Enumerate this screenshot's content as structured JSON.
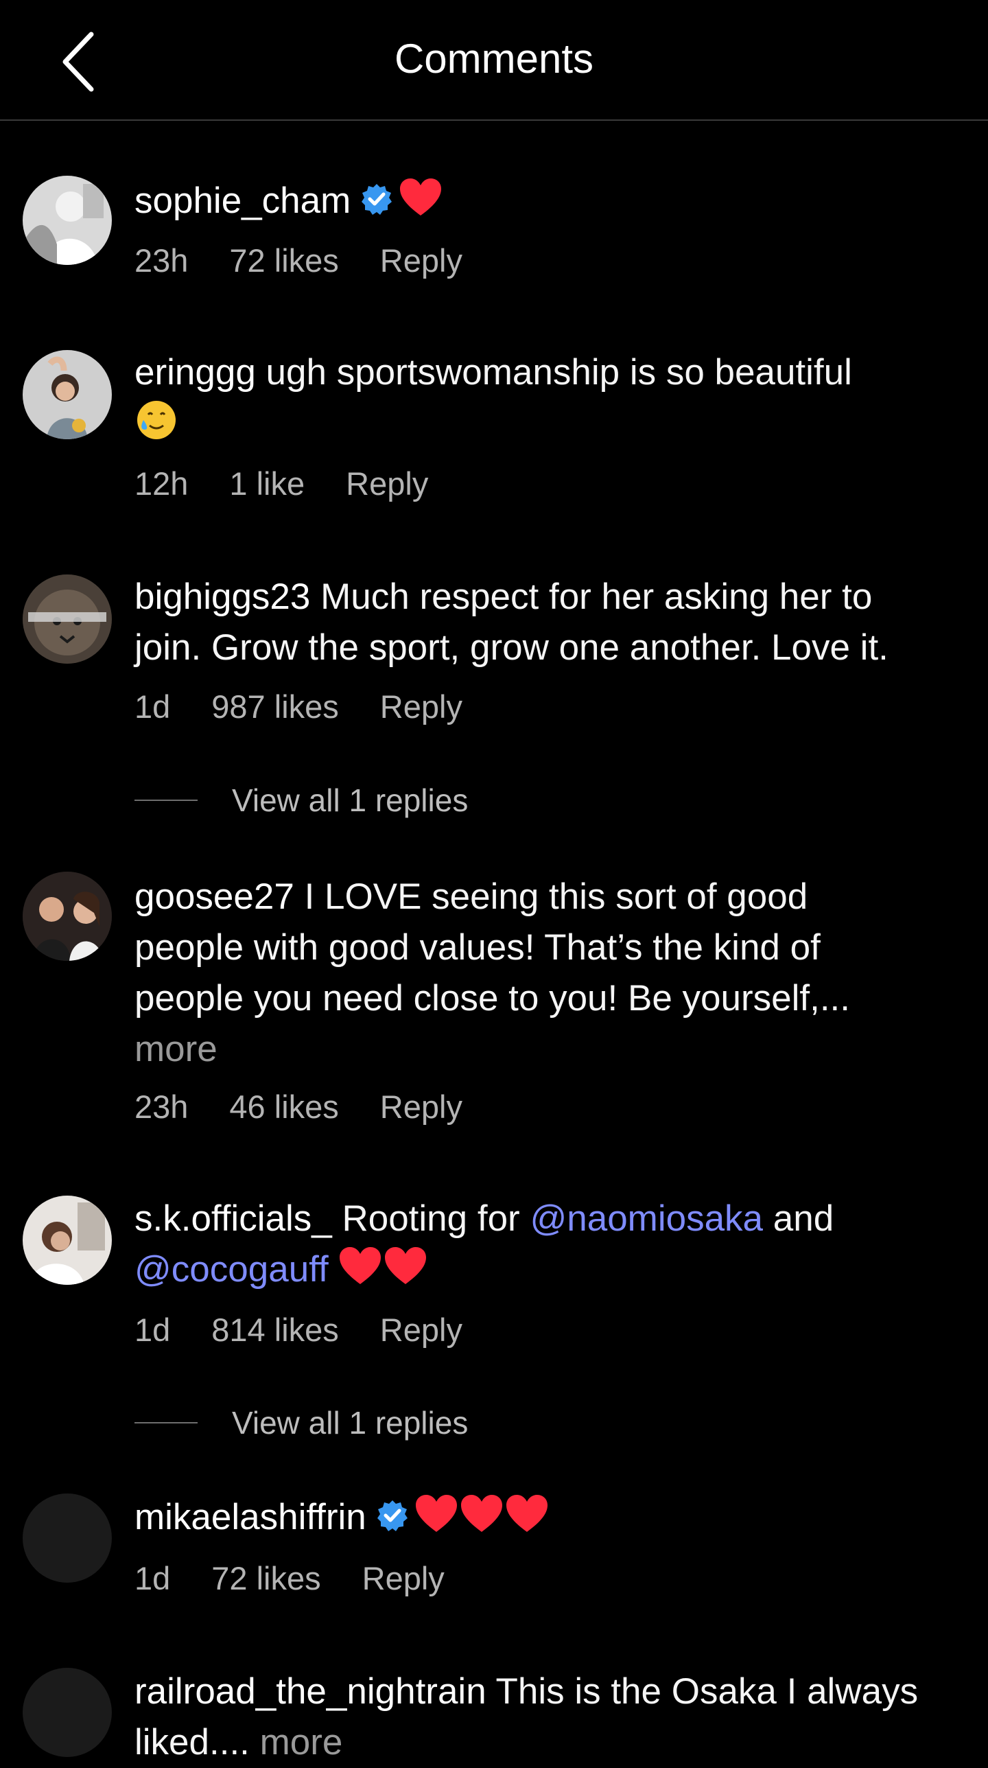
{
  "header": {
    "title": "Comments"
  },
  "comments": [
    {
      "username": "sophie_cham",
      "verified": true,
      "text": "",
      "hearts": 1,
      "time": "23h",
      "likes": "72 likes",
      "reply": "Reply"
    },
    {
      "username": "eringgg",
      "text": "ugh sportswomanship is so beautiful",
      "time": "12h",
      "likes": "1 like",
      "reply": "Reply"
    },
    {
      "username": "bighiggs23",
      "text_line1": "Much respect for her asking her to",
      "text_line2": "join. Grow the sport, grow one another. Love it.",
      "time": "1d",
      "likes": "987 likes",
      "reply": "Reply",
      "view_replies": "View all 1 replies"
    },
    {
      "username": "goosee27",
      "text_line1": "I LOVE seeing this sort of good",
      "text_line2": "people with good values! That’s the kind of",
      "text_line3": "people you need close to you! Be yourself,...",
      "more": "more",
      "time": "23h",
      "likes": "46 likes",
      "reply": "Reply"
    },
    {
      "username": "s.k.officials_",
      "text_a": "Rooting for",
      "mention1": "@naomiosaka",
      "text_b": "and",
      "mention2": "@cocogauff",
      "time": "1d",
      "likes": "814 likes",
      "reply": "Reply",
      "view_replies": "View all 1 replies"
    },
    {
      "username": "mikaelashiffrin",
      "verified": true,
      "time": "1d",
      "likes": "72 likes",
      "reply": "Reply"
    },
    {
      "username": "railroad_the_nightrain",
      "text_line1": "This is the Osaka I always",
      "text_line2": "liked....",
      "more": "more"
    }
  ],
  "colors": {
    "background": "#000000",
    "mention": "#7f8cff",
    "heart": "#ff2a3d",
    "verified": "#3897f0"
  },
  "icons": [
    "back-chevron-icon",
    "verified-icon",
    "heart-icon",
    "smiling-tear-emoji-icon"
  ]
}
